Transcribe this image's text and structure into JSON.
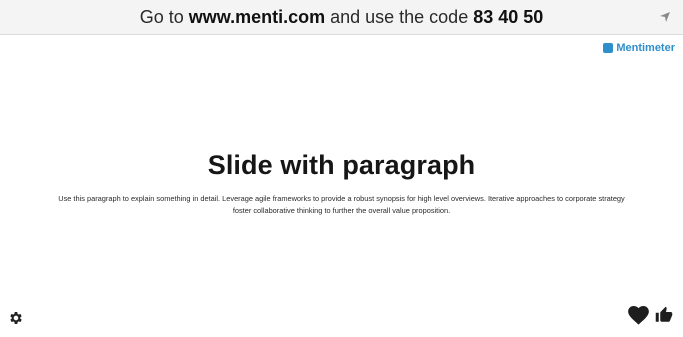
{
  "header": {
    "prefix": "Go to",
    "url": "www.menti.com",
    "middle": "and use the code",
    "code": "83 40 50",
    "arrow_icon": "navigation-arrow-icon"
  },
  "brand": {
    "name": "Mentimeter",
    "color": "#2f8fcc"
  },
  "slide": {
    "title": "Slide with paragraph",
    "paragraph": "Use this paragraph to explain something in detail. Leverage agile frameworks to provide a robust synopsis for high level overviews. Iterative approaches to corporate strategy foster collaborative thinking to further the overall value proposition."
  },
  "controls": {
    "settings_icon": "gear-icon",
    "heart_icon": "heart-icon",
    "thumb_icon": "thumbs-up-icon"
  }
}
